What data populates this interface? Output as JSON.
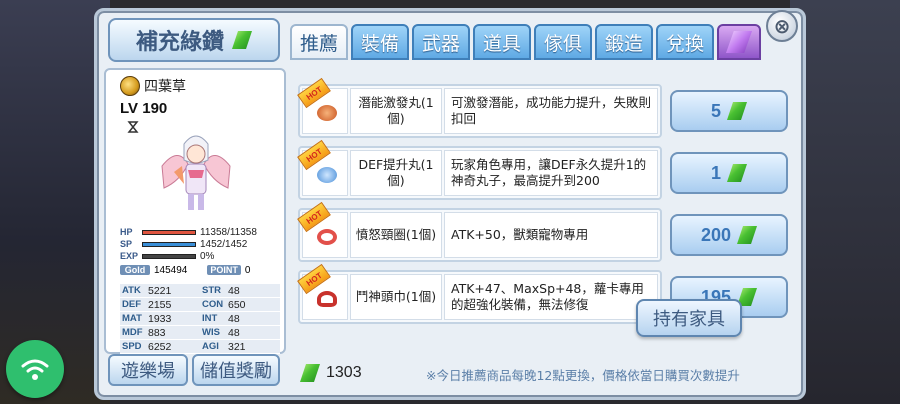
{
  "header": {
    "refill_label": "補充綠鑽",
    "close_glyph": "⊗"
  },
  "tabs": [
    {
      "label": "推薦",
      "active": true
    },
    {
      "label": "裝備",
      "active": false
    },
    {
      "label": "武器",
      "active": false
    },
    {
      "label": "道具",
      "active": false
    },
    {
      "label": "傢俱",
      "active": false
    },
    {
      "label": "鍛造",
      "active": false
    },
    {
      "label": "兌換",
      "active": false
    },
    {
      "label": "",
      "icon": "purple-gem-icon",
      "active": false
    }
  ],
  "character": {
    "name": "四葉草",
    "level": "LV 190",
    "hp_label": "HP",
    "hp_value": "11358/11358",
    "hp_fraction": 1.0,
    "sp_label": "SP",
    "sp_value": "1452/1452",
    "sp_fraction": 1.0,
    "exp_label": "EXP",
    "exp_value": "0%",
    "exp_fraction": 0.0,
    "gold_label": "Gold",
    "gold_value": "145494",
    "point_label": "POINT",
    "point_value": "0",
    "stats": [
      {
        "key": "ATK",
        "value": "5221"
      },
      {
        "key": "STR",
        "value": "48"
      },
      {
        "key": "DEF",
        "value": "2155"
      },
      {
        "key": "CON",
        "value": "650"
      },
      {
        "key": "MAT",
        "value": "1933"
      },
      {
        "key": "INT",
        "value": "48"
      },
      {
        "key": "MDF",
        "value": "883"
      },
      {
        "key": "WIS",
        "value": "48"
      },
      {
        "key": "SPD",
        "value": "6252"
      },
      {
        "key": "AGI",
        "value": "321"
      }
    ]
  },
  "bottom_buttons": {
    "playground": "遊樂場",
    "recharge_reward": "儲值獎勵"
  },
  "products": [
    {
      "hot": "HOT",
      "name": "潛能激發丸(1個)",
      "desc": "可激發潛能，成功能力提升，失敗則扣回",
      "price": "5",
      "icon": "pill-icon"
    },
    {
      "hot": "HOT",
      "name": "DEF提升丸(1個)",
      "desc": "玩家角色專用，讓DEF永久提升1的神奇丸子，最高提升到200",
      "price": "1",
      "icon": "def-pill-icon"
    },
    {
      "hot": "HOT",
      "name": "憤怒頸圈(1個)",
      "desc": "ATK+50，獸類寵物專用",
      "price": "200",
      "icon": "collar-icon"
    },
    {
      "hot": "HOT",
      "name": "鬥神頭巾(1個)",
      "desc": "ATK+47、MaxSp+48，蘿卡專用的超強化裝備，無法修復",
      "price": "195",
      "icon": "headband-icon"
    }
  ],
  "owned_furniture_label": "持有家具",
  "balance": "1303",
  "footnote": "※今日推薦商品每晚12點更換，價格依當日購買次數提升",
  "colors": {
    "hp": "#e0553f",
    "sp": "#3a8fd8",
    "exp": "#8fc341",
    "gem": "#49c032",
    "tab": "#5fa9e4"
  }
}
